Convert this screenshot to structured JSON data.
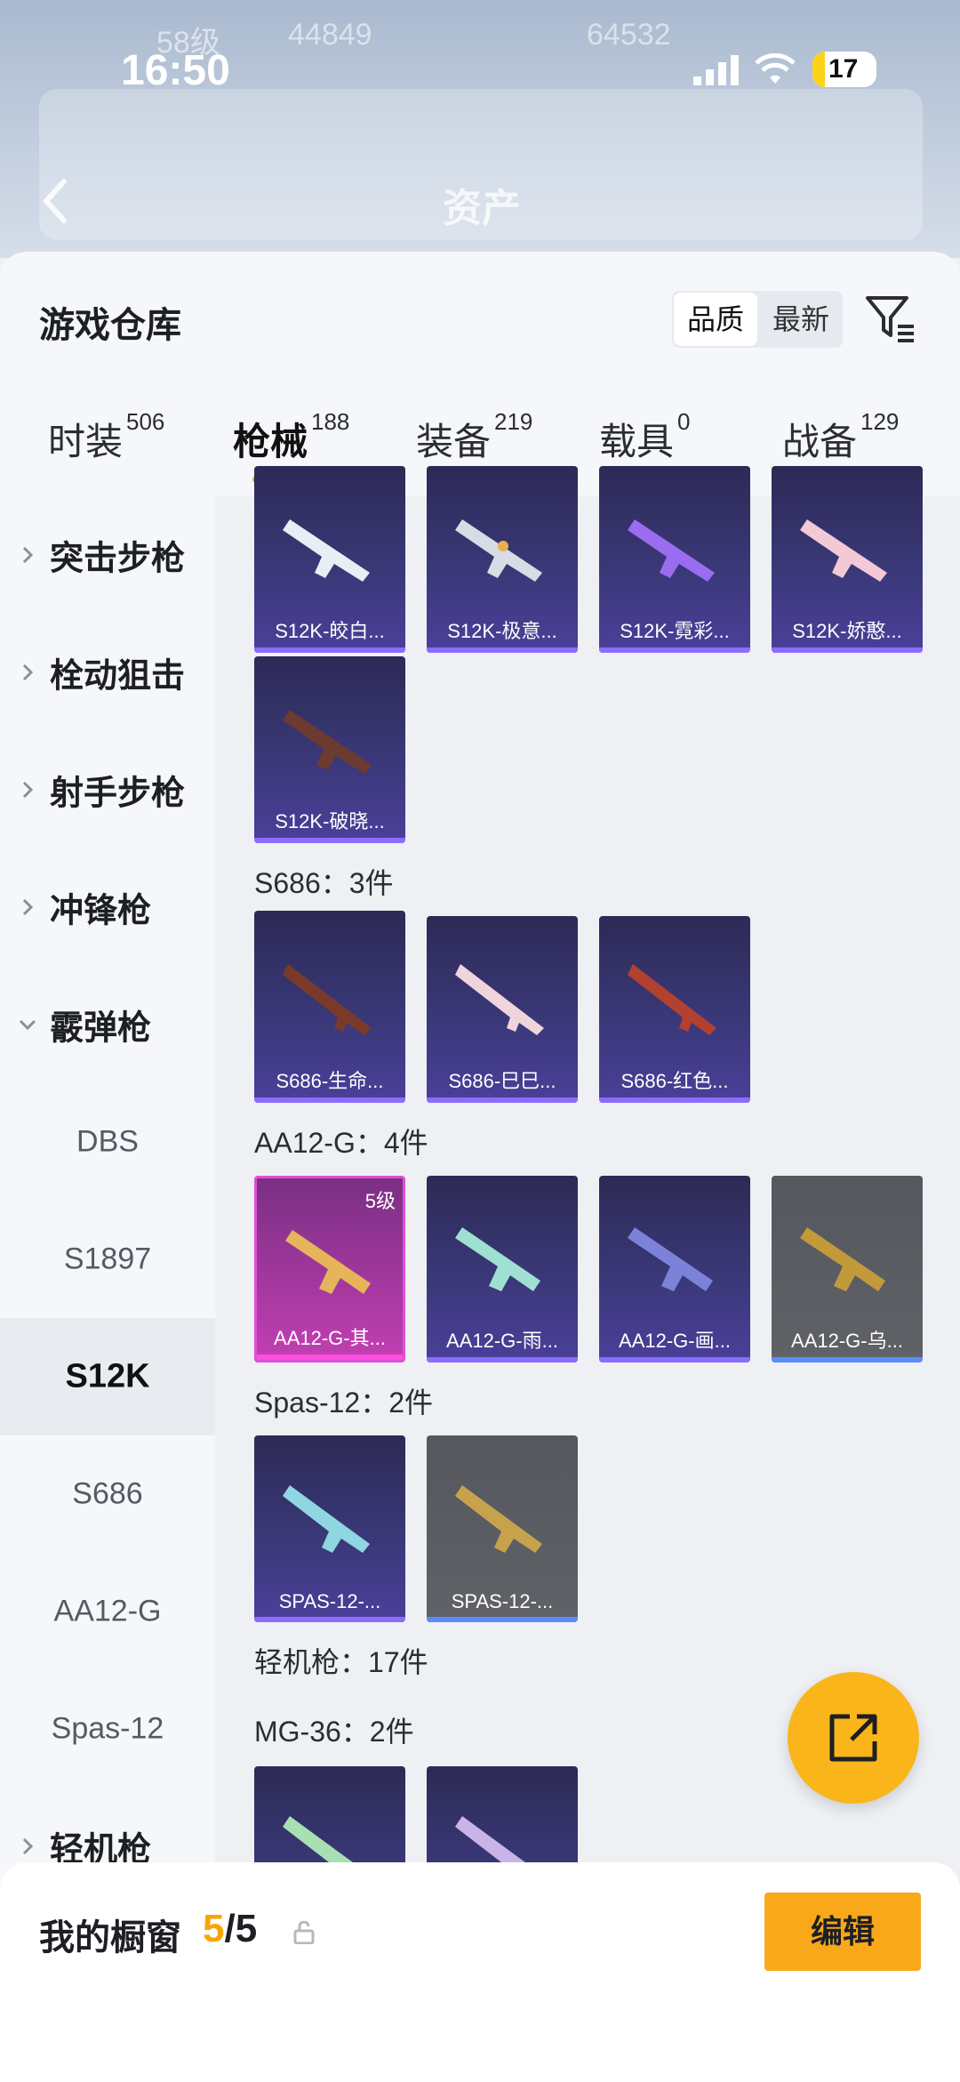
{
  "status_bar": {
    "time": "16:50",
    "battery": "17"
  },
  "background_header": {
    "title": "资产",
    "row1": [
      "58级",
      "44849",
      "64532"
    ]
  },
  "panel": {
    "title": "游戏仓库",
    "sort": {
      "options": [
        "品质",
        "最新"
      ],
      "selected": "品质"
    }
  },
  "tabs": [
    {
      "label": "时装",
      "count": "506"
    },
    {
      "label": "枪械",
      "count": "188",
      "active": true
    },
    {
      "label": "装备",
      "count": "219"
    },
    {
      "label": "载具",
      "count": "0"
    },
    {
      "label": "战备",
      "count": "129"
    }
  ],
  "sidebar": [
    {
      "label": "突击步枪",
      "type": "category"
    },
    {
      "label": "栓动狙击",
      "type": "category"
    },
    {
      "label": "射手步枪",
      "type": "category"
    },
    {
      "label": "冲锋枪",
      "type": "category"
    },
    {
      "label": "霰弹枪",
      "type": "category-open"
    },
    {
      "label": "DBS",
      "type": "sub"
    },
    {
      "label": "S1897",
      "type": "sub"
    },
    {
      "label": "S12K",
      "type": "sub",
      "selected": true
    },
    {
      "label": "S686",
      "type": "sub"
    },
    {
      "label": "AA12-G",
      "type": "sub"
    },
    {
      "label": "Spas-12",
      "type": "sub"
    },
    {
      "label": "轻机枪",
      "type": "category"
    }
  ],
  "groups": {
    "s12k_items": [
      "S12K-皎白...",
      "S12K-极意...",
      "S12K-霓彩...",
      "S12K-娇憨...",
      "S12K-破晓..."
    ],
    "s686": {
      "label": "S686：3件",
      "items": [
        "S686-生命...",
        "S686-巳巳...",
        "S686-红色..."
      ]
    },
    "aa12": {
      "label": "AA12-G：4件",
      "items": [
        "AA12-G-其...",
        "AA12-G-雨...",
        "AA12-G-画...",
        "AA12-G-乌..."
      ],
      "level_badge": "5级"
    },
    "spas": {
      "label": "Spas-12：2件",
      "items": [
        "SPAS-12-...",
        "SPAS-12-..."
      ]
    },
    "lmg": {
      "label": "轻机枪：17件"
    },
    "mg36": {
      "label": "MG-36：2件"
    }
  },
  "bottom_bar": {
    "label": "我的橱窗",
    "current": "5",
    "total": "/5",
    "edit": "编辑"
  },
  "colors": {
    "accent": "#f7a600",
    "card_purple": "#3a3878",
    "card_gray": "#5a5c63",
    "card_pink": "#c23fb2"
  },
  "icons": [
    "filter-icon",
    "chevron-right-icon",
    "chevron-down-icon",
    "share-icon",
    "lock-icon",
    "back-icon",
    "signal-icon",
    "wifi-icon"
  ]
}
